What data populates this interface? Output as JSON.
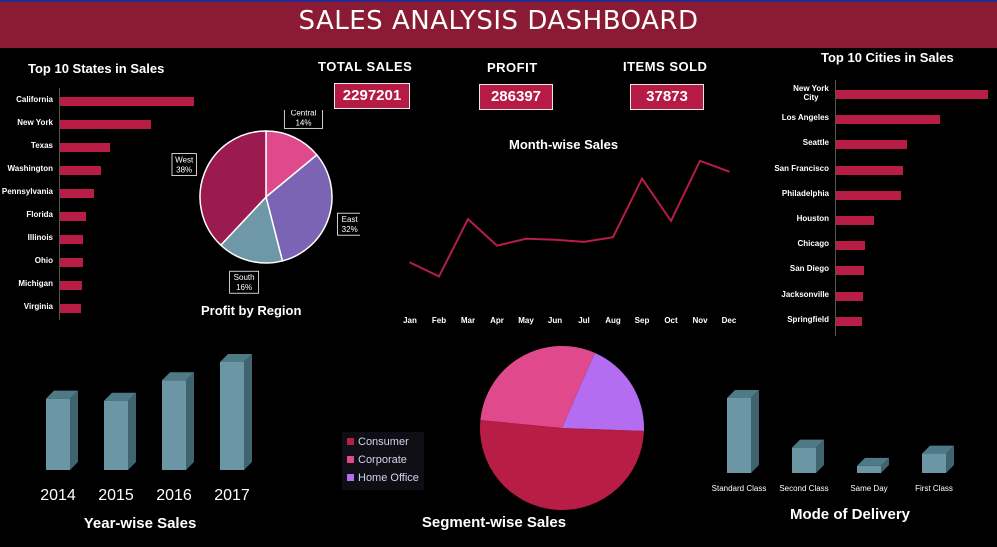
{
  "dashboard": {
    "title": "SALES ANALYSIS DASHBOARD"
  },
  "kpis": [
    {
      "label": "TOTAL SALES",
      "value": "2297201"
    },
    {
      "label": "PROFIT",
      "value": "286397"
    },
    {
      "label": "ITEMS SOLD",
      "value": "37873"
    }
  ],
  "colors": {
    "bar": "#b81d45",
    "column": "#6a97a3",
    "title_bar": "#8b1a34"
  },
  "chart_data": [
    {
      "type": "bar",
      "title": "Top 10 States in Sales",
      "categories": [
        "California",
        "New York",
        "Texas",
        "Washington",
        "Pennsylvania",
        "Florida",
        "Illinois",
        "Ohio",
        "Michigan",
        "Virginia"
      ],
      "values": [
        457688,
        310876,
        170188,
        138641,
        116512,
        89474,
        80166,
        78258,
        76270,
        70637
      ]
    },
    {
      "type": "pie",
      "title": "Profit by Region",
      "categories": [
        "Central",
        "East",
        "South",
        "West"
      ],
      "values": [
        14,
        32,
        16,
        38
      ],
      "colors": [
        "#e0498c",
        "#7c64b5",
        "#6f98a6",
        "#9b1a4f"
      ]
    },
    {
      "type": "line",
      "title": "Month-wise Sales",
      "categories": [
        "Jan",
        "Feb",
        "Mar",
        "Apr",
        "May",
        "Jun",
        "Jul",
        "Aug",
        "Sep",
        "Oct",
        "Nov",
        "Dec"
      ],
      "values": [
        94925,
        59751,
        205005,
        137762,
        155029,
        152719,
        147238,
        159044,
        307650,
        200323,
        352461,
        325293
      ]
    },
    {
      "type": "bar",
      "title": "Top 10 Cities in Sales",
      "categories": [
        "New York City",
        "Los Angeles",
        "Seattle",
        "San Francisco",
        "Philadelphia",
        "Houston",
        "Chicago",
        "San Diego",
        "Jacksonville",
        "Springfield"
      ],
      "values": [
        256368,
        175851,
        119541,
        112669,
        109077,
        64505,
        48540,
        47521,
        44713,
        43054
      ]
    },
    {
      "type": "bar",
      "title": "Year-wise Sales",
      "categories": [
        "2014",
        "2015",
        "2016",
        "2017"
      ],
      "values": [
        484247,
        470533,
        609206,
        733215
      ]
    },
    {
      "type": "pie",
      "title": "Segment-wise Sales",
      "categories": [
        "Consumer",
        "Corporate",
        "Home Office"
      ],
      "values": [
        51,
        30,
        19
      ],
      "colors": [
        "#b81d45",
        "#e0498c",
        "#b46cf0"
      ]
    },
    {
      "type": "bar",
      "title": "Mode of Delivery",
      "categories": [
        "Standard Class",
        "Second Class",
        "Same Day",
        "First Class"
      ],
      "values": [
        1358216,
        459194,
        128363,
        351428
      ]
    }
  ]
}
